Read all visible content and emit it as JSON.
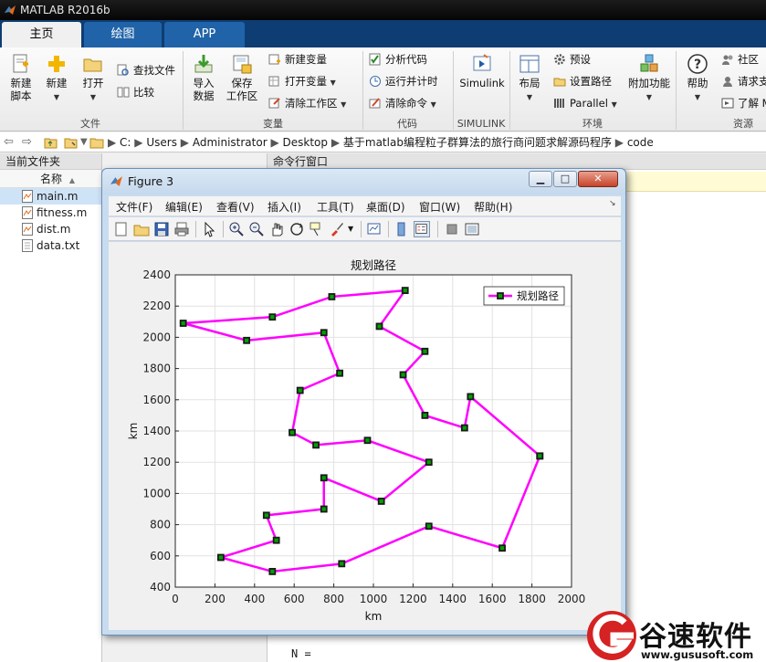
{
  "app": {
    "title": "MATLAB R2016b"
  },
  "tabs": [
    {
      "label": "主页"
    },
    {
      "label": "绘图"
    },
    {
      "label": "APP"
    }
  ],
  "ribbon": {
    "new_script": "新建\n脚本",
    "new": "新建",
    "open": "打开",
    "find_files": "查找文件",
    "compare": "比较",
    "import_data": "导入\n数据",
    "save_workspace": "保存\n工作区",
    "new_variable": "新建变量",
    "open_variable": "打开变量",
    "clear_workspace": "清除工作区",
    "analyze_code": "分析代码",
    "run_and_time": "运行并计时",
    "clear_commands": "清除命令",
    "simulink": "Simulink",
    "layout": "布局",
    "preferences": "预设",
    "set_path": "设置路径",
    "parallel": "Parallel",
    "addons": "附加功能",
    "help": "帮助",
    "community": "社区",
    "request_support": "请求支",
    "learn": "了解 M",
    "sections": {
      "file": "文件",
      "variable": "变量",
      "code": "代码",
      "simulink": "SIMULINK",
      "environment": "环境",
      "resources": "资源"
    }
  },
  "address": {
    "crumbs": [
      "C:",
      "Users",
      "Administrator",
      "Desktop",
      "基于matlab编程粒子群算法的旅行商问题求解源码程序",
      "code"
    ]
  },
  "current_folder": {
    "title": "当前文件夹",
    "column": "名称",
    "sort_indicator": "▲",
    "files": [
      {
        "name": "main.m",
        "selected": true
      },
      {
        "name": "fitness.m",
        "selected": false
      },
      {
        "name": "dist.m",
        "selected": false
      },
      {
        "name": "data.txt",
        "selected": false
      }
    ]
  },
  "command_window": {
    "title": "命令行窗口",
    "last_line": "N ="
  },
  "figure": {
    "title": "Figure 3",
    "menu": [
      "文件(F)",
      "编辑(E)",
      "查看(V)",
      "插入(I)",
      "工具(T)",
      "桌面(D)",
      "窗口(W)",
      "帮助(H)"
    ],
    "buttons": {
      "minimize": "▁",
      "maximize": "□",
      "close": "✕"
    }
  },
  "chart_data": {
    "type": "line",
    "title": "规划路径",
    "xlabel": "km",
    "ylabel": "km",
    "xlim": [
      0,
      2000
    ],
    "ylim": [
      400,
      2400
    ],
    "xticks": [
      0,
      200,
      400,
      600,
      800,
      1000,
      1200,
      1400,
      1600,
      1800,
      2000
    ],
    "yticks": [
      400,
      600,
      800,
      1000,
      1200,
      1400,
      1600,
      1800,
      2000,
      2200,
      2400
    ],
    "grid": true,
    "legend": "top-right",
    "line_color": "#ff00ff",
    "marker_edge": "#1a1a1a",
    "marker_face": "#00a000",
    "series": [
      {
        "name": "规划路径",
        "x": [
          1840,
          1490,
          1460,
          1260,
          1150,
          1260,
          1030,
          1160,
          790,
          490,
          40,
          360,
          750,
          830,
          630,
          590,
          710,
          970,
          1280,
          1040,
          750,
          750,
          460,
          510,
          230,
          490,
          840,
          1280,
          1650,
          1840
        ],
        "y": [
          1240,
          1620,
          1420,
          1500,
          1760,
          1910,
          2070,
          2300,
          2260,
          2130,
          2090,
          1980,
          2030,
          1770,
          1660,
          1390,
          1310,
          1340,
          1200,
          950,
          1100,
          900,
          860,
          700,
          590,
          500,
          550,
          790,
          650,
          1240
        ]
      }
    ]
  },
  "watermark": {
    "text": "谷速软件",
    "url": "www.gususoft.com"
  }
}
